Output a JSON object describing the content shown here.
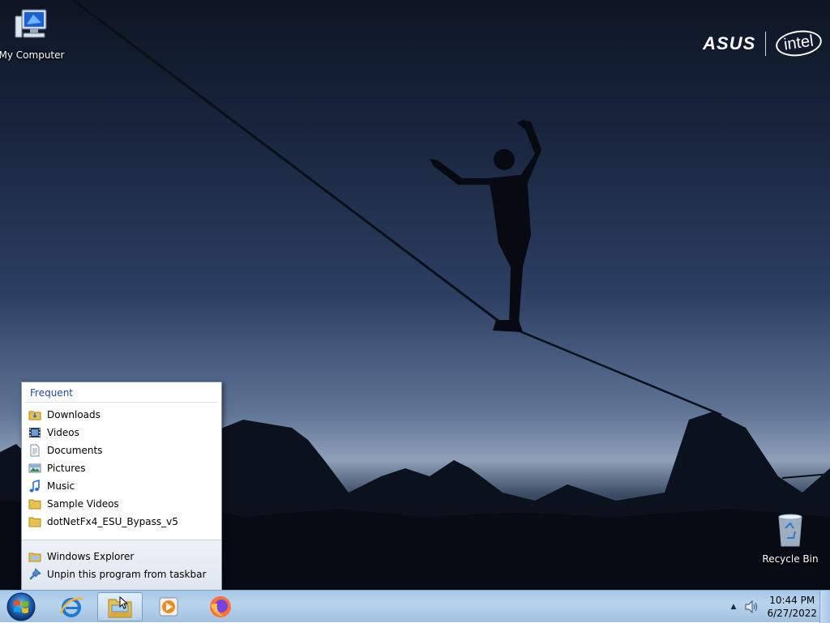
{
  "desktop": {
    "icons": {
      "my_computer": "My Computer",
      "recycle_bin": "Recycle Bin"
    },
    "brand": {
      "left": "ASUS",
      "right": "intel"
    }
  },
  "jumplist": {
    "section_title": "Frequent",
    "items": [
      {
        "label": "Downloads",
        "icon": "downloads-folder-icon"
      },
      {
        "label": "Videos",
        "icon": "videos-library-icon"
      },
      {
        "label": "Documents",
        "icon": "documents-library-icon"
      },
      {
        "label": "Pictures",
        "icon": "pictures-library-icon"
      },
      {
        "label": "Music",
        "icon": "music-library-icon"
      },
      {
        "label": "Sample Videos",
        "icon": "folder-icon"
      },
      {
        "label": "dotNetFx4_ESU_Bypass_v5",
        "icon": "folder-icon"
      }
    ],
    "actions": [
      {
        "label": "Windows Explorer",
        "icon": "windows-explorer-icon"
      },
      {
        "label": "Unpin this program from taskbar",
        "icon": "unpin-icon"
      }
    ]
  },
  "taskbar": {
    "pinned": [
      {
        "name": "internet-explorer",
        "icon": "internet-explorer-icon"
      },
      {
        "name": "windows-explorer",
        "icon": "windows-explorer-icon",
        "active": true
      },
      {
        "name": "media-player",
        "icon": "media-player-icon"
      },
      {
        "name": "firefox",
        "icon": "firefox-icon"
      }
    ],
    "tray": {
      "time": "10:44 PM",
      "date": "6/27/2022"
    }
  },
  "colors": {
    "jumplist_title": "#1e4c9a",
    "taskbar": "#b9d4ee",
    "folder": "#e8c14e"
  }
}
